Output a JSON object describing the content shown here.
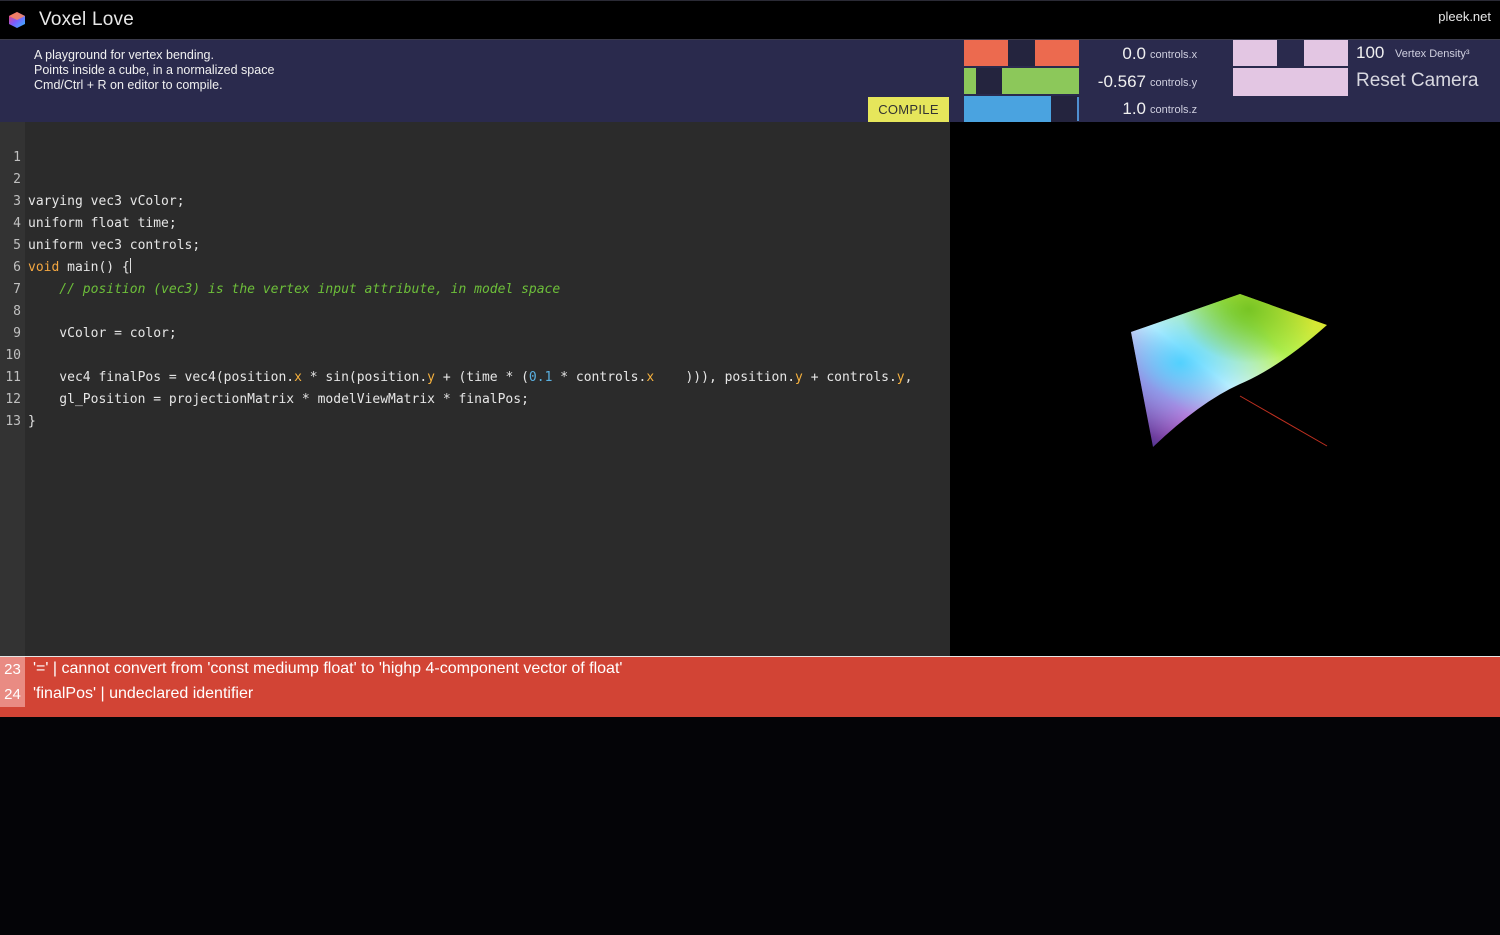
{
  "header": {
    "title": "Voxel Love",
    "site": "pleek.net"
  },
  "description": {
    "line1": "A playground for vertex bending.",
    "line2": "Points inside a cube, in a normalized space",
    "line3": "Cmd/Ctrl + R on editor to compile."
  },
  "compile_label": "COMPILE",
  "controls": [
    {
      "value": "0.0",
      "label": "controls.x",
      "color": "#ec6a4f"
    },
    {
      "value": "-0.567",
      "label": "controls.y",
      "color": "#8cc85a"
    },
    {
      "value": "1.0",
      "label": "controls.z",
      "color": "#4aa3e0"
    }
  ],
  "density": {
    "value": "100",
    "label": "Vertex Density³"
  },
  "reset_label": "Reset Camera",
  "editor": {
    "line_numbers": [
      "1",
      "2",
      "3",
      "4",
      "5",
      "6",
      "7",
      "8",
      "9",
      "10",
      "11",
      "12",
      "13"
    ],
    "lines": {
      "l2": "varying vec3 vColor;",
      "l3": "uniform float time;",
      "l4": "uniform vec3 controls;",
      "l5_kw": "void",
      "l5_rest": " main() {",
      "l6": "    // position (vec3) is the vertex input attribute, in model space",
      "l8": "    vColor = color;",
      "l10_a": "    vec4 finalPos = vec4(position.",
      "l10_b": "x",
      "l10_c": " * sin(position.",
      "l10_d": "y",
      "l10_e": " + (time * (",
      "l10_f": "0.1",
      "l10_g": " * controls.",
      "l10_h": "x",
      "l10_i": "    ))), position.",
      "l10_j": "y",
      "l10_k": " + controls.",
      "l10_l": "y",
      "l10_m": ",",
      "l11": "    gl_Position = projectionMatrix * modelViewMatrix * finalPos;",
      "l12": "}"
    }
  },
  "errors": [
    {
      "line": "23",
      "message": "'=' | cannot convert from 'const mediump float' to 'highp 4-component vector of float'"
    },
    {
      "line": "24",
      "message": "'finalPos' | undeclared identifier"
    }
  ]
}
